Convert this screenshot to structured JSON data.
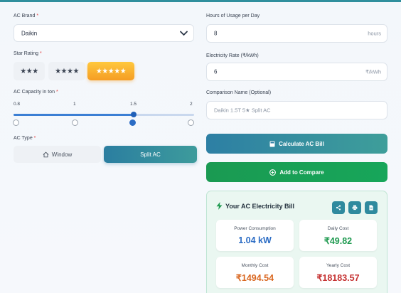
{
  "brand": {
    "label": "AC Brand",
    "value": "Daikin"
  },
  "stars": {
    "label": "Star Rating",
    "options": [
      "★★★",
      "★★★★",
      "★★★★★"
    ],
    "selected_index": 2
  },
  "capacity": {
    "label": "AC Capacity in ton",
    "ticks": [
      "0.8",
      "1",
      "1.5",
      "2"
    ],
    "value": 1.5,
    "min": 0.8,
    "max": 2
  },
  "type": {
    "label": "AC Type",
    "window_label": "Window",
    "split_label": "Split AC",
    "selected": "Split AC"
  },
  "usage": {
    "label": "Hours of Usage per Day",
    "value": "8",
    "unit": "hours"
  },
  "rate": {
    "label": "Electricity Rate (₹/kWh)",
    "value": "6",
    "unit": "₹/kWh"
  },
  "comparison": {
    "label": "Comparison Name (Optional)",
    "placeholder": "Daikin 1.5T 5★ Split AC"
  },
  "buttons": {
    "calculate": "Calculate AC Bill",
    "compare": "Add to Compare"
  },
  "result": {
    "title": "Your AC Electricity Bill",
    "cards": [
      {
        "title": "Power Consumption",
        "value": "1.04 kW",
        "color": "#2b6cc4"
      },
      {
        "title": "Daily Cost",
        "value": "₹49.82",
        "color": "#1f9a50"
      },
      {
        "title": "Monthly Cost",
        "value": "₹1494.54",
        "color": "#d9661f"
      },
      {
        "title": "Yearly Cost",
        "value": "₹18183.57",
        "color": "#c53030"
      }
    ]
  },
  "colors": {
    "accent": "#2f8a9e",
    "star_active": "#f59d24",
    "compare": "#17a65a",
    "required": "#e53e3e"
  }
}
